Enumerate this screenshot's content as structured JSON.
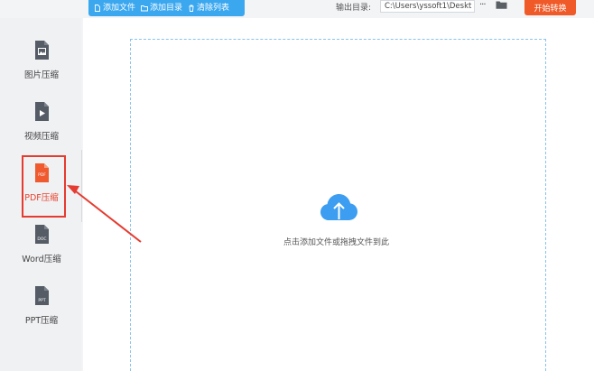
{
  "toolbar": {
    "add_file": "添加文件",
    "add_folder": "添加目录",
    "clear_list": "清除列表",
    "output_label": "输出目录:",
    "output_path": "C:\\Users\\yssoft1\\Deskt",
    "more": "···",
    "start": "开始转换"
  },
  "sidebar": {
    "items": [
      {
        "label": "图片压缩",
        "icon_text": ""
      },
      {
        "label": "视频压缩",
        "icon_text": ""
      },
      {
        "label": "PDF压缩",
        "icon_text": "PDF"
      },
      {
        "label": "Word压缩",
        "icon_text": "DOC"
      },
      {
        "label": "PPT压缩",
        "icon_text": "PPT"
      }
    ]
  },
  "main": {
    "drop_hint": "点击添加文件或拖拽文件到此"
  },
  "colors": {
    "accent_blue": "#3aa7ef",
    "start_orange": "#f05a28",
    "active_red": "#e53b30"
  }
}
